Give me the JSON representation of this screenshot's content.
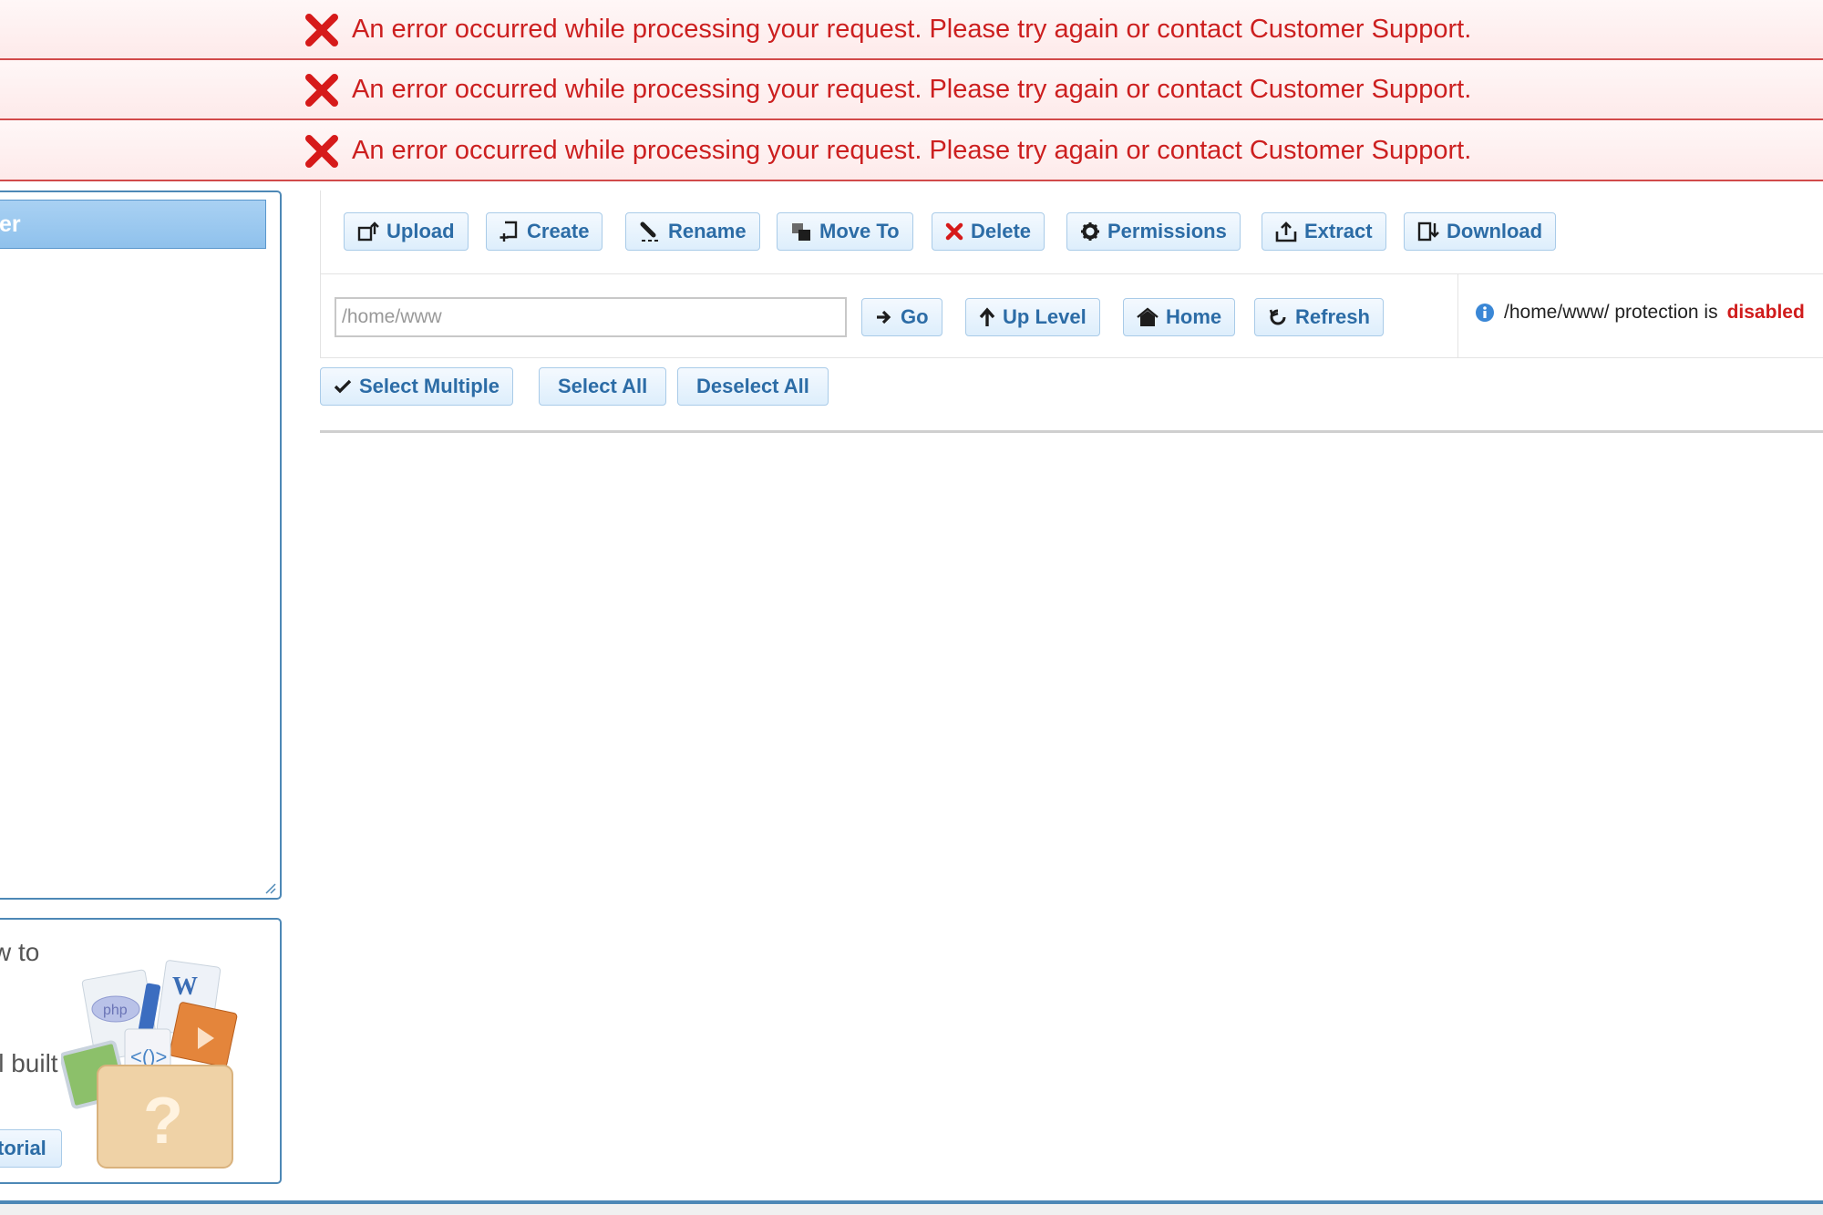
{
  "errors": [
    {
      "message": "An error occurred while processing your request. Please try again or contact Customer Support."
    },
    {
      "message": "An error occurred while processing your request. Please try again or contact Customer Support."
    },
    {
      "message": "An error occurred while processing your request. Please try again or contact Customer Support."
    }
  ],
  "tree": {
    "header_label": "er"
  },
  "help": {
    "line1": "w to",
    "line2": "ll built",
    "line3": ".",
    "tutorial_label": "torial"
  },
  "toolbar": {
    "buttons": [
      {
        "label": "Upload",
        "icon": "upload-icon"
      },
      {
        "label": "Create",
        "icon": "create-icon"
      },
      {
        "label": "Rename",
        "icon": "rename-icon"
      },
      {
        "label": "Move To",
        "icon": "move-icon"
      },
      {
        "label": "Delete",
        "icon": "delete-icon"
      },
      {
        "label": "Permissions",
        "icon": "gear-icon"
      },
      {
        "label": "Extract",
        "icon": "extract-icon"
      },
      {
        "label": "Download",
        "icon": "download-icon"
      }
    ]
  },
  "path": {
    "value": "/home/www",
    "go_label": "Go",
    "up_label": "Up Level",
    "home_label": "Home",
    "refresh_label": "Refresh"
  },
  "protection": {
    "path": "/home/www/ protection is",
    "state": "disabled"
  },
  "selection": {
    "select_multiple_label": "Select Multiple",
    "select_all_label": "Select All",
    "deselect_all_label": "Deselect All"
  },
  "colors": {
    "error_text": "#cc1f1f",
    "accent": "#2c6ca6",
    "panel_border": "#4d88b6"
  }
}
